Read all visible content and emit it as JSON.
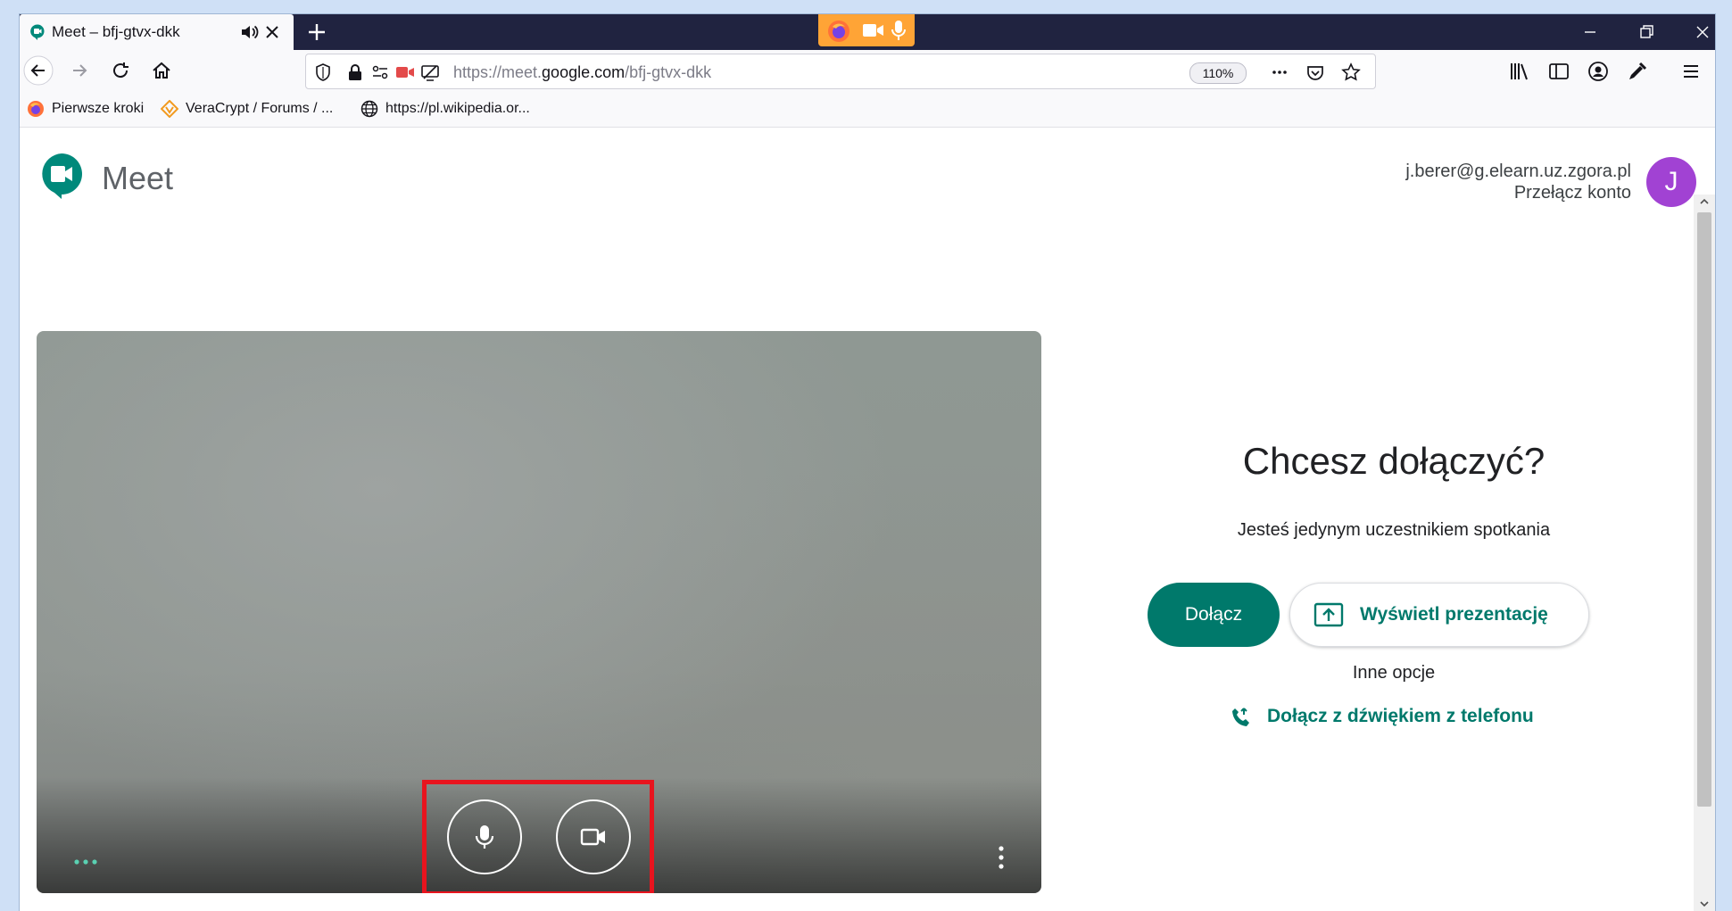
{
  "browser": {
    "tab": {
      "title": "Meet – bfj-gtvx-dkk",
      "icon": "meet-icon"
    },
    "url_prefix": "https://meet.",
    "url_domain": "google.com",
    "url_path": "/bfj-gtvx-dkk",
    "zoom": "110%",
    "bookmarks": [
      {
        "label": "Pierwsze kroki",
        "icon": "firefox-icon"
      },
      {
        "label": "VeraCrypt / Forums / ...",
        "icon": "veracrypt-icon"
      },
      {
        "label": "https://pl.wikipedia.or...",
        "icon": "globe-icon"
      }
    ]
  },
  "header": {
    "product": "Meet",
    "account_email": "j.berer@g.elearn.uz.zgora.pl",
    "switch_account": "Przełącz konto",
    "avatar_letter": "J",
    "avatar_color": "#a142d3"
  },
  "join": {
    "title": "Chcesz dołączyć?",
    "subtitle": "Jesteś jedynym uczestnikiem spotkania",
    "join_label": "Dołącz",
    "present_label": "Wyświetl prezentację",
    "other_options": "Inne opcje",
    "phone_label": "Dołącz z dźwiękiem z telefonu"
  },
  "colors": {
    "accent": "#00796b",
    "highlight": "#e8141e",
    "tabstrip": "#202340",
    "sharing": "#ffa436"
  }
}
